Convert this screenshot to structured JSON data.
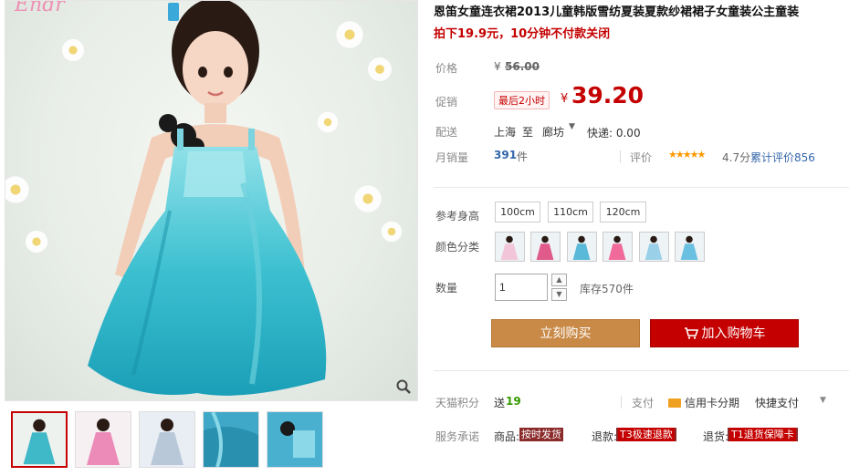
{
  "gallery": {
    "logo_text": "Endr",
    "zoom_icon": "magnifier-icon",
    "thumbnails": [
      {
        "color": "#3fb8c8",
        "active": true
      },
      {
        "color": "#ec8ab8",
        "active": false
      },
      {
        "color": "#b8c8d8",
        "active": false
      },
      {
        "color": "#3fa8c8",
        "active": false
      },
      {
        "color": "#4ab0d0",
        "active": false
      }
    ]
  },
  "product": {
    "title": "恩笛女童连衣裙2013儿童韩版雪纺夏装夏款纱裙裙子女童装公主童装",
    "subtitle": "拍下19.9元，10分钟不付款关闭"
  },
  "price": {
    "label": "价格",
    "currency": "¥",
    "original": "56.00"
  },
  "promo": {
    "label": "促销",
    "badge": "最后2小时",
    "currency": "¥",
    "price": "39.20"
  },
  "shipping": {
    "label": "配送",
    "from": "上海",
    "to_word": "至",
    "to": "廊坊",
    "express": "快递: 0.00"
  },
  "sales": {
    "label": "月销量",
    "count": "391",
    "unit": "件",
    "review_label": "评价",
    "stars": "★★★★★",
    "score": "4.7分",
    "total_reviews": "累计评价856"
  },
  "sizes": {
    "label": "参考身高",
    "options": [
      "100cm",
      "110cm",
      "120cm"
    ]
  },
  "colors": {
    "label": "颜色分类",
    "swatches": [
      "#f2c6d8",
      "#e05a8a",
      "#5ab8d8",
      "#f06a9a",
      "#9ad0e8",
      "#6ac0e0"
    ]
  },
  "quantity": {
    "label": "数量",
    "value": "1",
    "stock": "库存570件"
  },
  "actions": {
    "buy_now": "立刻购买",
    "add_to_cart": "加入购物车"
  },
  "points": {
    "label": "天猫积分",
    "prefix": "送",
    "value": "19",
    "pay_label": "支付",
    "credit": "信用卡分期",
    "quick_pay": "快捷支付"
  },
  "service": {
    "label": "服务承诺",
    "goods": "商品:",
    "goods_tag": "按时发货",
    "refund": "退款:",
    "refund_tag": "T3极速退款",
    "return": "退货:",
    "return_tag": "T1退货保障卡"
  },
  "colors_theme": {
    "accent_red": "#c40000",
    "buy_orange": "#c98a48",
    "link_blue": "#3366aa",
    "points_green": "#339900"
  }
}
